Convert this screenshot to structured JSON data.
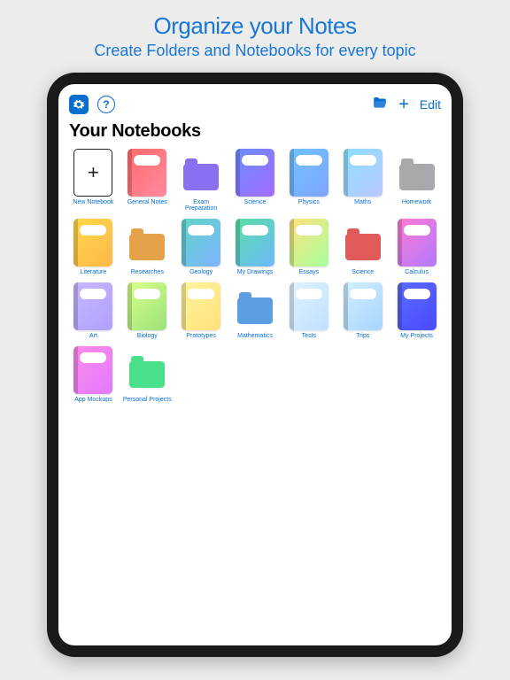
{
  "marketing": {
    "title": "Organize your Notes",
    "subtitle": "Create Folders and Notebooks for every topic"
  },
  "toolbar": {
    "edit_label": "Edit"
  },
  "page_title": "Your Notebooks",
  "items": [
    {
      "kind": "new",
      "label": "New Notebook"
    },
    {
      "kind": "nb",
      "label": "General Notes",
      "bg": "linear-gradient(135deg,#ff6b6b,#ff8a9e)"
    },
    {
      "kind": "folder",
      "label": "Exam Preparation",
      "color": "#8a6ff0"
    },
    {
      "kind": "nb",
      "label": "Science",
      "bg": "linear-gradient(135deg,#6a8dff,#a56bff)"
    },
    {
      "kind": "nb",
      "label": "Physics",
      "bg": "linear-gradient(135deg,#6fc3ff,#7ea4ff)"
    },
    {
      "kind": "nb",
      "label": "Maths",
      "bg": "linear-gradient(135deg,#8de0ff,#b9c8ff)"
    },
    {
      "kind": "folder",
      "label": "Homework",
      "color": "#a8a8ad"
    },
    {
      "kind": "nb",
      "label": "Literature",
      "bg": "linear-gradient(135deg,#ffd84a,#ffb74a)"
    },
    {
      "kind": "folder",
      "label": "Researches",
      "color": "#e6a24a"
    },
    {
      "kind": "nb",
      "label": "Geology",
      "bg": "linear-gradient(135deg,#5fd6c9,#7fb3ff)"
    },
    {
      "kind": "nb",
      "label": "My Drawings",
      "bg": "linear-gradient(135deg,#56e0a0,#6fb8ff)"
    },
    {
      "kind": "nb",
      "label": "Essays",
      "bg": "linear-gradient(135deg,#ffe27a,#a6ff9e)"
    },
    {
      "kind": "folder",
      "label": "Science",
      "color": "#e05a5a"
    },
    {
      "kind": "nb",
      "label": "Calculus",
      "bg": "linear-gradient(135deg,#ff7ad1,#b07aff)"
    },
    {
      "kind": "nb",
      "label": "Art",
      "bg": "linear-gradient(135deg,#c9b6ff,#b0a0ff)"
    },
    {
      "kind": "nb",
      "label": "Biology",
      "bg": "linear-gradient(135deg,#d9ff8a,#9be27a)"
    },
    {
      "kind": "nb",
      "label": "Prototypes",
      "bg": "linear-gradient(135deg,#fff59e,#ffe07a)"
    },
    {
      "kind": "folder",
      "label": "Mathematics",
      "color": "#5a9de0"
    },
    {
      "kind": "nb",
      "label": "Tests",
      "bg": "linear-gradient(135deg,#e0f3ff,#c0e0ff)"
    },
    {
      "kind": "nb",
      "label": "Trips",
      "bg": "linear-gradient(135deg,#d0f0ff,#a8d4ff)"
    },
    {
      "kind": "nb",
      "label": "My Projects",
      "bg": "linear-gradient(135deg,#5a6bff,#4a4aff)"
    },
    {
      "kind": "nb",
      "label": "App Mockups",
      "bg": "linear-gradient(135deg,#ff8ae8,#e07aff)"
    },
    {
      "kind": "folder",
      "label": "Personal Projects",
      "color": "#4ae08a"
    }
  ]
}
